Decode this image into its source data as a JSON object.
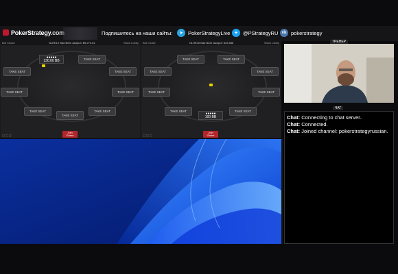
{
  "banner": {
    "logo_text": "PokerStrategy",
    "logo_domain": ".com",
    "subscribe_text": "Подпишитесь на наши сайты:",
    "socials": [
      {
        "icon": "telegram-icon",
        "label": "PokerStrategyLive"
      },
      {
        "icon": "twitter-icon",
        "label": "@PStrategyRU"
      },
      {
        "icon": "vk-icon",
        "label": "pokerstrategy"
      }
    ],
    "brand_color": "#c0172d"
  },
  "tables": [
    {
      "header_left": "Bot Choke",
      "header_center": "NLHE10 Bad Beat Jackpot: $9,270.61",
      "header_right": "Show Lobby",
      "seats": [
        "TAKE SEAT",
        "TAKE SEAT",
        "TAKE SEAT",
        "TAKE SEAT",
        "TAKE SEAT",
        "TAKE SEAT",
        "TAKE SEAT",
        "TAKE SEAT"
      ],
      "player_stack": "130.00 BB",
      "player_name": "●●●●●",
      "join_label_1": "Join",
      "join_label_2": "Game"
    },
    {
      "header_left": "Bot Choke",
      "header_center": "NLHE30 Bad Beat Jackpot: $33,588",
      "header_right": "Show Lobby",
      "seats": [
        "TAKE SEAT",
        "TAKE SEAT",
        "TAKE SEAT",
        "TAKE SEAT",
        "TAKE SEAT",
        "TAKE SEAT",
        "TAKE SEAT",
        "TAKE SEAT"
      ],
      "player_stack": "100 BB",
      "player_name": "●●●●●",
      "join_label_1": "Join",
      "join_label_2": "Game"
    }
  ],
  "webcam": {
    "label": "ТРЕНЕР"
  },
  "chat": {
    "label": "ЧАТ",
    "messages": [
      {
        "who": "Chat:",
        "text": "Connecting to chat server.."
      },
      {
        "who": "Chat:",
        "text": "Connected."
      },
      {
        "who": "Chat:",
        "text": "Joined channel: pokerstrategyrussian."
      }
    ]
  }
}
